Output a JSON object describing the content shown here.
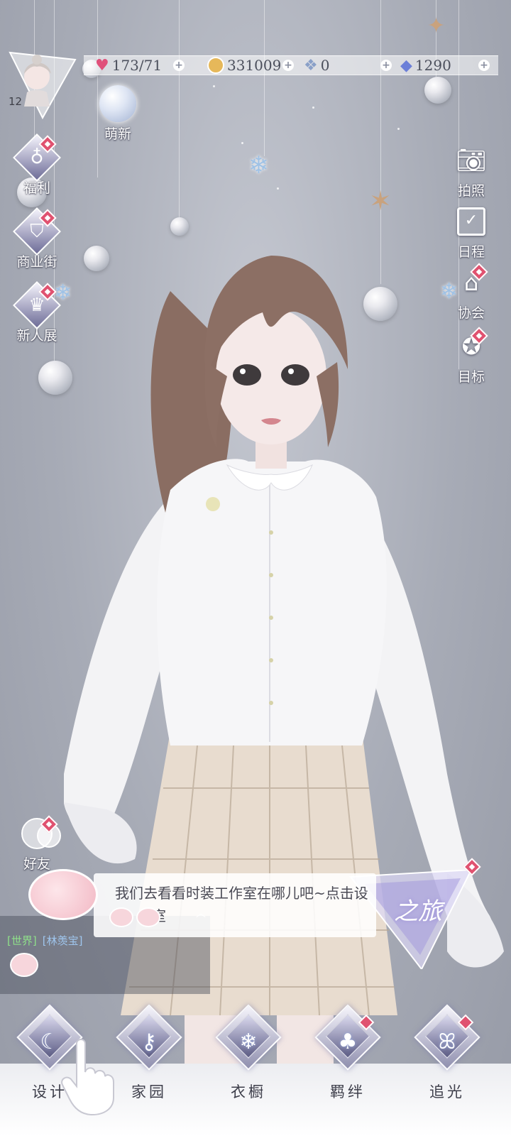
{
  "resources": {
    "stamina": "173/71",
    "coins": "331009",
    "crystal": "0",
    "diamond": "1290"
  },
  "player": {
    "level": "12"
  },
  "left_menu": [
    {
      "label": "萌新",
      "icon": "bubble-orb-icon"
    },
    {
      "label": "福利",
      "icon": "balloon-icon"
    },
    {
      "label": "商业街",
      "icon": "shopping-bag-icon"
    },
    {
      "label": "新人展",
      "icon": "crown-star-icon"
    }
  ],
  "right_menu": [
    {
      "label": "拍照",
      "icon": "camera-icon"
    },
    {
      "label": "日程",
      "icon": "calendar-check-icon"
    },
    {
      "label": "协会",
      "icon": "guild-building-icon"
    },
    {
      "label": "目标",
      "icon": "target-badge-icon"
    }
  ],
  "friends": {
    "label": "好友"
  },
  "dialog": {
    "text": "我们去看看时装工作室在哪儿吧~点击设",
    "text2": "室"
  },
  "chat": {
    "channel": "[世界]",
    "user": "[林羡宝]"
  },
  "bottom_nav": [
    {
      "label": "设计",
      "icon": "moon-needle-icon",
      "badge": false
    },
    {
      "label": "家园",
      "icon": "key-icon",
      "badge": false
    },
    {
      "label": "衣橱",
      "icon": "snowflake-gem-icon",
      "badge": false
    },
    {
      "label": "羁绊",
      "icon": "clover-icon",
      "badge": true
    },
    {
      "label": "追光",
      "icon": "butterfly-icon",
      "badge": true
    }
  ],
  "journey": {
    "text": "之旅"
  },
  "colors": {
    "accent_badge": "#e05270",
    "nav_text": "#3d3e4a",
    "side_label": "#ffffff"
  }
}
